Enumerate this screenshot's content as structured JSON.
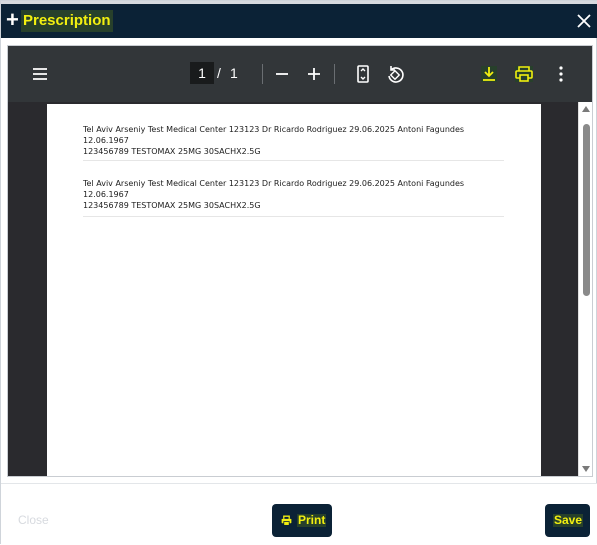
{
  "dialog": {
    "title": "Prescription",
    "plus_glyph": "+"
  },
  "viewer": {
    "current_page": "1",
    "separator": "/",
    "total_pages": "1",
    "entries": [
      {
        "line1": "Tel Aviv  Arseniy Test Medical Center  123123  Dr Ricardo Rodriguez  29.06.2025  Antoni Fagundes  12.06.1967",
        "line2": "123456789  TESTOMAX    25MG  30SACHX2.5G"
      },
      {
        "line1": "Tel Aviv  Arseniy Test Medical Center  123123  Dr Ricardo Rodriguez  29.06.2025  Antoni Fagundes  12.06.1967",
        "line2": "123456789  TESTOMAX    25MG  30SACHX2.5G"
      }
    ]
  },
  "footer": {
    "close_label": "Close",
    "print_label": "Print",
    "save_label": "Save"
  },
  "colors": {
    "header_bg": "#0b2236",
    "accent_yellow": "#f2ef10",
    "pdf_toolbar": "#323639"
  }
}
